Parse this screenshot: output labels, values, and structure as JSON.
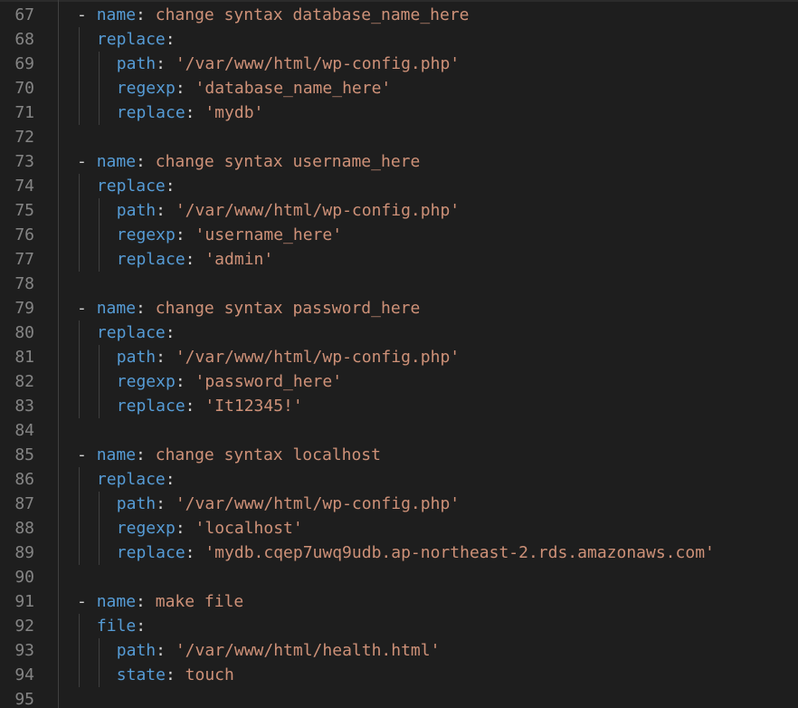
{
  "colors": {
    "background": "#1e1e1e",
    "line_number": "#858585",
    "key": "#569cd6",
    "string": "#ce9178",
    "punctuation": "#d4d4d4"
  },
  "lines": [
    {
      "num": "67",
      "dash": "- ",
      "key": "name",
      "colon": ": ",
      "value": "change syntax database_name_here"
    },
    {
      "num": "68",
      "dash": "",
      "key": "replace",
      "colon": ":",
      "value": ""
    },
    {
      "num": "69",
      "dash": "",
      "key": "path",
      "colon": ": ",
      "value": "'/var/www/html/wp-config.php'"
    },
    {
      "num": "70",
      "dash": "",
      "key": "regexp",
      "colon": ": ",
      "value": "'database_name_here'"
    },
    {
      "num": "71",
      "dash": "",
      "key": "replace",
      "colon": ": ",
      "value": "'mydb'"
    },
    {
      "num": "72",
      "dash": "",
      "key": "",
      "colon": "",
      "value": ""
    },
    {
      "num": "73",
      "dash": "- ",
      "key": "name",
      "colon": ": ",
      "value": "change syntax username_here"
    },
    {
      "num": "74",
      "dash": "",
      "key": "replace",
      "colon": ":",
      "value": ""
    },
    {
      "num": "75",
      "dash": "",
      "key": "path",
      "colon": ": ",
      "value": "'/var/www/html/wp-config.php'"
    },
    {
      "num": "76",
      "dash": "",
      "key": "regexp",
      "colon": ": ",
      "value": "'username_here'"
    },
    {
      "num": "77",
      "dash": "",
      "key": "replace",
      "colon": ": ",
      "value": "'admin'"
    },
    {
      "num": "78",
      "dash": "",
      "key": "",
      "colon": "",
      "value": ""
    },
    {
      "num": "79",
      "dash": "- ",
      "key": "name",
      "colon": ": ",
      "value": "change syntax password_here"
    },
    {
      "num": "80",
      "dash": "",
      "key": "replace",
      "colon": ":",
      "value": ""
    },
    {
      "num": "81",
      "dash": "",
      "key": "path",
      "colon": ": ",
      "value": "'/var/www/html/wp-config.php'"
    },
    {
      "num": "82",
      "dash": "",
      "key": "regexp",
      "colon": ": ",
      "value": "'password_here'"
    },
    {
      "num": "83",
      "dash": "",
      "key": "replace",
      "colon": ": ",
      "value": "'It12345!'"
    },
    {
      "num": "84",
      "dash": "",
      "key": "",
      "colon": "",
      "value": ""
    },
    {
      "num": "85",
      "dash": "- ",
      "key": "name",
      "colon": ": ",
      "value": "change syntax localhost"
    },
    {
      "num": "86",
      "dash": "",
      "key": "replace",
      "colon": ":",
      "value": ""
    },
    {
      "num": "87",
      "dash": "",
      "key": "path",
      "colon": ": ",
      "value": "'/var/www/html/wp-config.php'"
    },
    {
      "num": "88",
      "dash": "",
      "key": "regexp",
      "colon": ": ",
      "value": "'localhost'"
    },
    {
      "num": "89",
      "dash": "",
      "key": "replace",
      "colon": ": ",
      "value": "'mydb.cqep7uwq9udb.ap-northeast-2.rds.amazonaws.com'"
    },
    {
      "num": "90",
      "dash": "",
      "key": "",
      "colon": "",
      "value": ""
    },
    {
      "num": "91",
      "dash": "- ",
      "key": "name",
      "colon": ": ",
      "value": "make file"
    },
    {
      "num": "92",
      "dash": "",
      "key": "file",
      "colon": ":",
      "value": ""
    },
    {
      "num": "93",
      "dash": "",
      "key": "path",
      "colon": ": ",
      "value": "'/var/www/html/health.html'"
    },
    {
      "num": "94",
      "dash": "",
      "key": "state",
      "colon": ": ",
      "value": "touch"
    },
    {
      "num": "95",
      "dash": "",
      "key": "",
      "colon": "",
      "value": ""
    }
  ]
}
